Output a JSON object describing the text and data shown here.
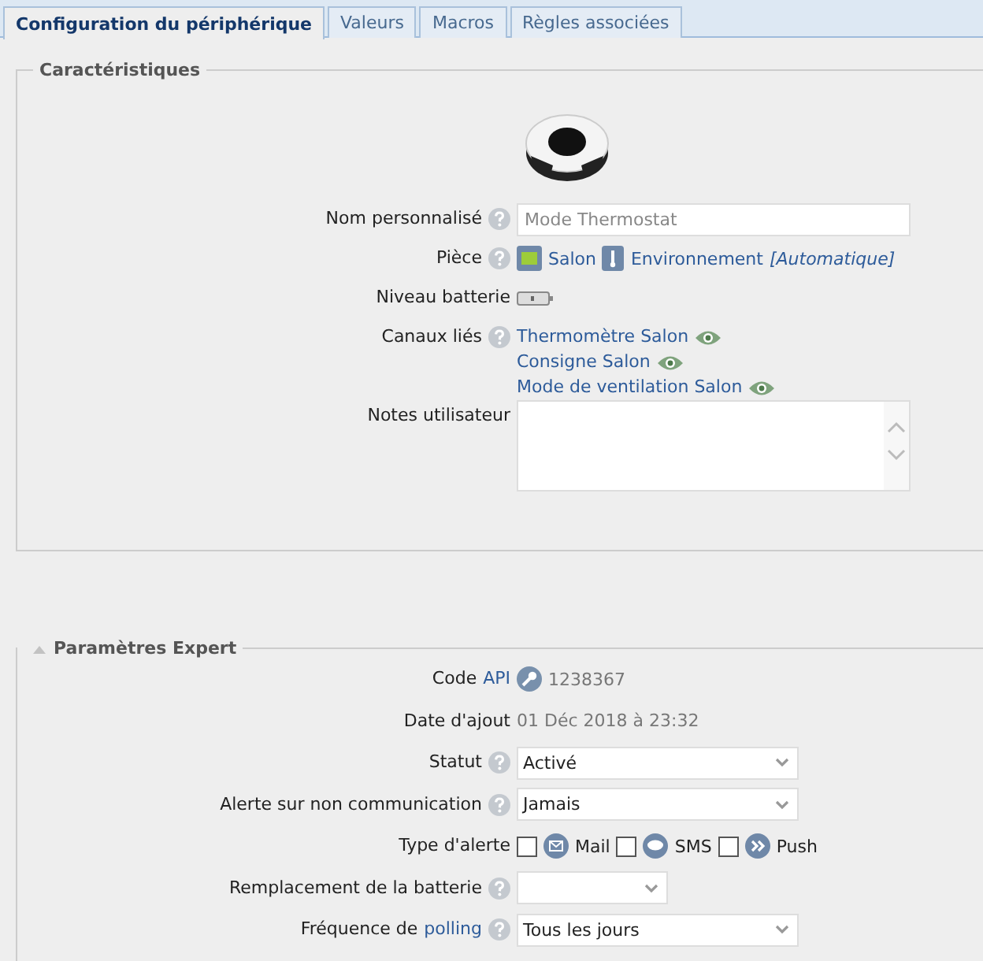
{
  "tabs": [
    {
      "label": "Configuration du périphérique",
      "selected": true
    },
    {
      "label": "Valeurs",
      "selected": false
    },
    {
      "label": "Macros",
      "selected": false
    },
    {
      "label": "Règles associées",
      "selected": false
    }
  ],
  "characteristics": {
    "legend": "Caractéristiques",
    "rows": [
      {
        "kind": "text",
        "label": "Nom personnalisé",
        "help": true,
        "placeholder": "Mode Thermostat"
      },
      {
        "kind": "room",
        "label": "Pièce",
        "help": true,
        "room": "Salon",
        "category": "Environnement",
        "mode": "[Automatique]"
      },
      {
        "kind": "battery",
        "label": "Niveau batterie",
        "help": false
      },
      {
        "kind": "channels",
        "label": "Canaux liés",
        "help": true,
        "channels": [
          "Thermomètre Salon",
          "Consigne Salon",
          "Mode de ventilation Salon"
        ]
      },
      {
        "kind": "textarea",
        "label": "Notes utilisateur",
        "help": false
      }
    ]
  },
  "expert": {
    "legend": "Paramètres Expert",
    "expanded": true,
    "rows": [
      {
        "kind": "code",
        "label": "Code",
        "link": "API",
        "help": false,
        "value": "1238367"
      },
      {
        "kind": "date",
        "label": "Date d'ajout",
        "help": false,
        "value": "01 Déc 2018 à 23:32"
      },
      {
        "kind": "select",
        "label": "Statut",
        "help": true,
        "value": "Activé",
        "wide": true
      },
      {
        "kind": "select",
        "label": "Alerte sur non communication",
        "help": true,
        "value": "Jamais",
        "wide": true
      },
      {
        "kind": "checks",
        "label": "Type d'alerte",
        "help": false,
        "options": [
          {
            "kind": "mail",
            "label": "Mail",
            "checked": false
          },
          {
            "kind": "sms",
            "label": "SMS",
            "checked": false
          },
          {
            "kind": "push",
            "label": "Push",
            "checked": false
          }
        ]
      },
      {
        "kind": "select",
        "label": "Remplacement de la batterie",
        "help": true,
        "value": "",
        "wide": false
      },
      {
        "kind": "select",
        "label": "Fréquence de",
        "link": "polling",
        "help": true,
        "value": "Tous les jours",
        "wide": true
      }
    ]
  }
}
